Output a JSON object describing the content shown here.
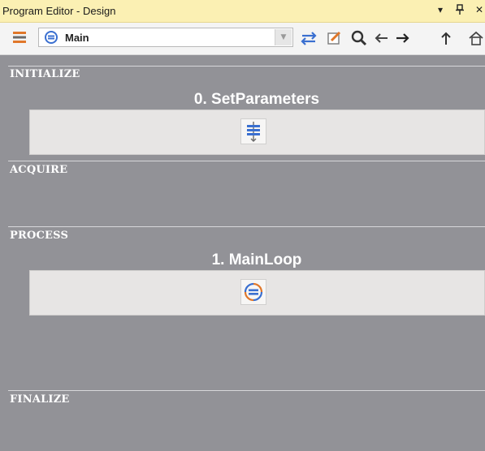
{
  "window": {
    "title": "Program Editor - Design",
    "controls": {
      "dropdown": "▾",
      "pin": "⇩",
      "close": "✕"
    }
  },
  "toolbar": {
    "program_select": {
      "value": "Main",
      "icon": "loop-icon"
    },
    "icons": [
      "list-icon",
      "swap-arrows-icon",
      "edit-icon",
      "search-icon",
      "back-arrow-icon",
      "forward-arrow-icon",
      "up-arrow-icon",
      "home-icon"
    ]
  },
  "stages": {
    "initialize": {
      "label": "INITIALIZE"
    },
    "acquire": {
      "label": "ACQUIRE"
    },
    "process": {
      "label": "PROCESS"
    },
    "finalize": {
      "label": "FINALIZE"
    }
  },
  "steps": [
    {
      "title": "0. SetParameters",
      "icon": "sequence-icon"
    },
    {
      "title": "1. MainLoop",
      "icon": "loop-icon"
    }
  ],
  "colors": {
    "titlebar_bg": "#fbf0b3",
    "canvas_bg": "#929297",
    "accent_blue": "#3a6fd0",
    "accent_orange": "#e0772a"
  }
}
